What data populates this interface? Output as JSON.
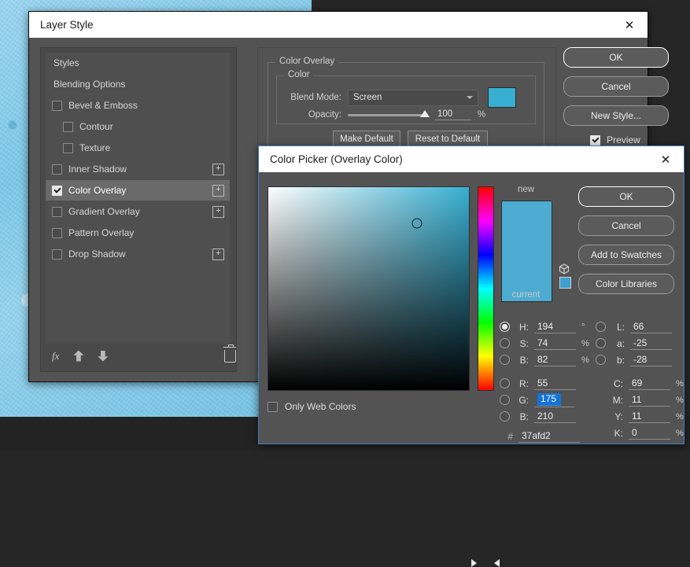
{
  "layer_style": {
    "title": "Layer Style",
    "close_icon": "close-icon",
    "styles": [
      {
        "label": "Styles",
        "type": "plain",
        "checked": null,
        "plus": false,
        "selected": false
      },
      {
        "label": "Blending Options",
        "type": "plain",
        "checked": null,
        "plus": false,
        "selected": false
      },
      {
        "label": "Bevel & Emboss",
        "type": "check",
        "checked": false,
        "plus": false,
        "selected": false
      },
      {
        "label": "Contour",
        "type": "indent",
        "checked": false,
        "plus": false,
        "selected": false
      },
      {
        "label": "Texture",
        "type": "indent",
        "checked": false,
        "plus": false,
        "selected": false
      },
      {
        "label": "Inner Shadow",
        "type": "check",
        "checked": false,
        "plus": true,
        "selected": false
      },
      {
        "label": "Color Overlay",
        "type": "check",
        "checked": true,
        "plus": true,
        "selected": true
      },
      {
        "label": "Gradient Overlay",
        "type": "check",
        "checked": false,
        "plus": true,
        "selected": false
      },
      {
        "label": "Pattern Overlay",
        "type": "check",
        "checked": false,
        "plus": false,
        "selected": false
      },
      {
        "label": "Drop Shadow",
        "type": "check",
        "checked": false,
        "plus": true,
        "selected": false
      }
    ],
    "tools": {
      "fx_label": "fx",
      "move_up": "arrow-up-icon",
      "move_down": "arrow-down-icon",
      "delete": "trash-icon"
    },
    "overlay_group": {
      "legend": "Color Overlay",
      "color_group_legend": "Color",
      "blend_mode_label": "Blend Mode:",
      "blend_mode_value": "Screen",
      "swatch_color": "#37afd2",
      "opacity_label": "Opacity:",
      "opacity_value": "100",
      "opacity_unit": "%",
      "opacity_percent": 100,
      "make_default": "Make Default",
      "reset_to_default": "Reset to Default"
    },
    "buttons": {
      "ok": "OK",
      "cancel": "Cancel",
      "new_style": "New Style...",
      "preview_label": "Preview",
      "preview_checked": true
    }
  },
  "color_picker": {
    "title": "Color Picker (Overlay Color)",
    "close_icon": "close-icon",
    "field": {
      "marker_x_percent": 74,
      "marker_y_percent": 18,
      "hue_color": "#37afd2"
    },
    "hue": {
      "position_percent": 54
    },
    "preview": {
      "new_label": "new",
      "current_label": "current",
      "new_color": "#4cacd1",
      "current_color": "#4cacd1",
      "web_warning_icon": "web-safe-cube-icon",
      "web_safe_swatch": "#3e9fd0"
    },
    "buttons": {
      "ok": "OK",
      "cancel": "Cancel",
      "add_to_swatches": "Add to Swatches",
      "color_libraries": "Color Libraries"
    },
    "only_web_colors": {
      "label": "Only Web Colors",
      "checked": false
    },
    "values": {
      "hsb": [
        {
          "key": "H",
          "label": "H:",
          "value": "194",
          "unit": "°",
          "radio": true
        },
        {
          "key": "S",
          "label": "S:",
          "value": "74",
          "unit": "%",
          "radio": false
        },
        {
          "key": "B",
          "label": "B:",
          "value": "82",
          "unit": "%",
          "radio": false
        }
      ],
      "rgb": [
        {
          "key": "R",
          "label": "R:",
          "value": "55",
          "unit": "",
          "radio": false,
          "editing": false
        },
        {
          "key": "G",
          "label": "G:",
          "value": "175",
          "unit": "",
          "radio": false,
          "editing": true
        },
        {
          "key": "B",
          "label": "B:",
          "value": "210",
          "unit": "",
          "radio": false,
          "editing": false
        }
      ],
      "lab": [
        {
          "key": "L",
          "label": "L:",
          "value": "66",
          "unit": "",
          "radio": false
        },
        {
          "key": "a",
          "label": "a:",
          "value": "-25",
          "unit": "",
          "radio": false
        },
        {
          "key": "b",
          "label": "b:",
          "value": "-28",
          "unit": "",
          "radio": false
        }
      ],
      "cmyk": [
        {
          "key": "C",
          "label": "C:",
          "value": "69",
          "unit": "%"
        },
        {
          "key": "M",
          "label": "M:",
          "value": "11",
          "unit": "%"
        },
        {
          "key": "Y",
          "label": "Y:",
          "value": "11",
          "unit": "%"
        },
        {
          "key": "K",
          "label": "K:",
          "value": "0",
          "unit": "%"
        }
      ],
      "hex_hash": "#",
      "hex_value": "37afd2"
    }
  }
}
